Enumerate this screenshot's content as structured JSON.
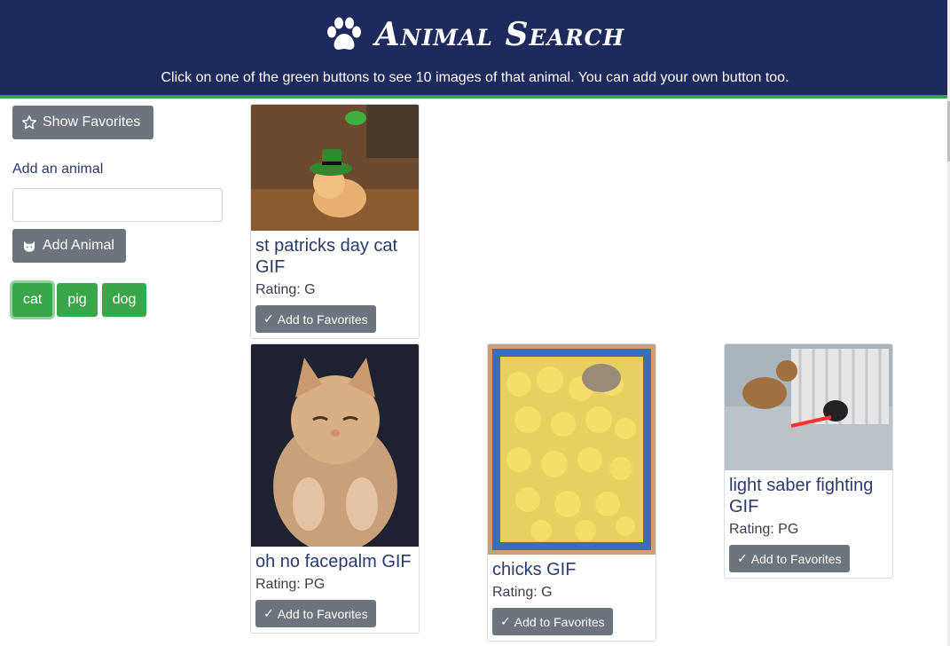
{
  "header": {
    "title": "Animal Search",
    "subtitle": "Click on one of the green buttons to see 10 images of that animal. You can add your own button too.",
    "bg_color": "#1f2a5c",
    "accent_color": "#3aa04a"
  },
  "sidebar": {
    "show_favorites_label": "Show Favorites",
    "add_label": "Add an animal",
    "input_value": "",
    "input_placeholder": "",
    "add_button_label": "Add Animal",
    "animal_buttons": [
      {
        "label": "cat",
        "active": true
      },
      {
        "label": "pig",
        "active": false
      },
      {
        "label": "dog",
        "active": false
      }
    ]
  },
  "results": [
    {
      "caption": "st patricks day cat GIF",
      "rating": "Rating: G",
      "fav_label": "Add to Favorites",
      "check": "✓"
    },
    {
      "caption": "oh no facepalm GIF",
      "rating": "Rating: PG",
      "fav_label": "Add to Favorites",
      "check": "✓"
    },
    {
      "caption": "chicks GIF",
      "rating": "Rating: G",
      "fav_label": "Add to Favorites",
      "check": "✓"
    },
    {
      "caption": "light saber fighting GIF",
      "rating": "Rating: PG",
      "fav_label": "Add to Favorites",
      "check": "✓"
    }
  ]
}
